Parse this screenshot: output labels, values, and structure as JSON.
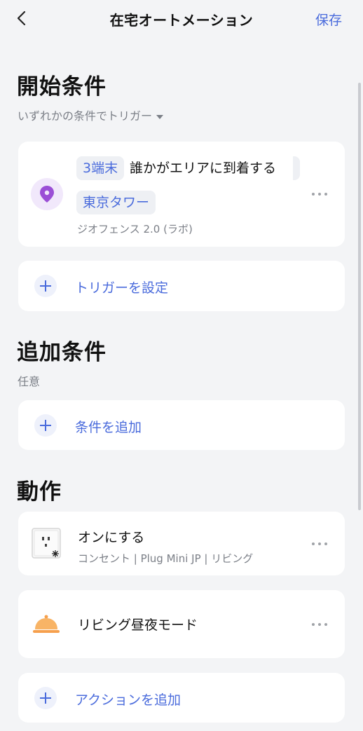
{
  "header": {
    "title": "在宅オートメーション",
    "save_label": "保存"
  },
  "start_conditions": {
    "heading": "開始条件",
    "mode": "いずれかの条件でトリガー",
    "trigger": {
      "devices_chip": "3端末",
      "event_text": "誰かがエリアに到着する",
      "location_chip": "東京タワー",
      "source": "ジオフェンス 2.0 (ラボ)"
    },
    "add_trigger_label": "トリガーを設定"
  },
  "additional_conditions": {
    "heading": "追加条件",
    "optional_label": "任意",
    "add_condition_label": "条件を追加"
  },
  "actions": {
    "heading": "動作",
    "items": [
      {
        "title": "オンにする",
        "subtitle": "コンセント | Plug Mini JP | リビング",
        "icon": "smart-plug-icon"
      },
      {
        "title": "リビング昼夜モード",
        "icon": "scene-bell-icon"
      }
    ],
    "add_action_label": "アクションを追加"
  },
  "colors": {
    "accent": "#4a6bdc",
    "background": "#f3f4f6",
    "location_pin": "#9b4fd6",
    "scene_orange": "#f6a04d"
  }
}
